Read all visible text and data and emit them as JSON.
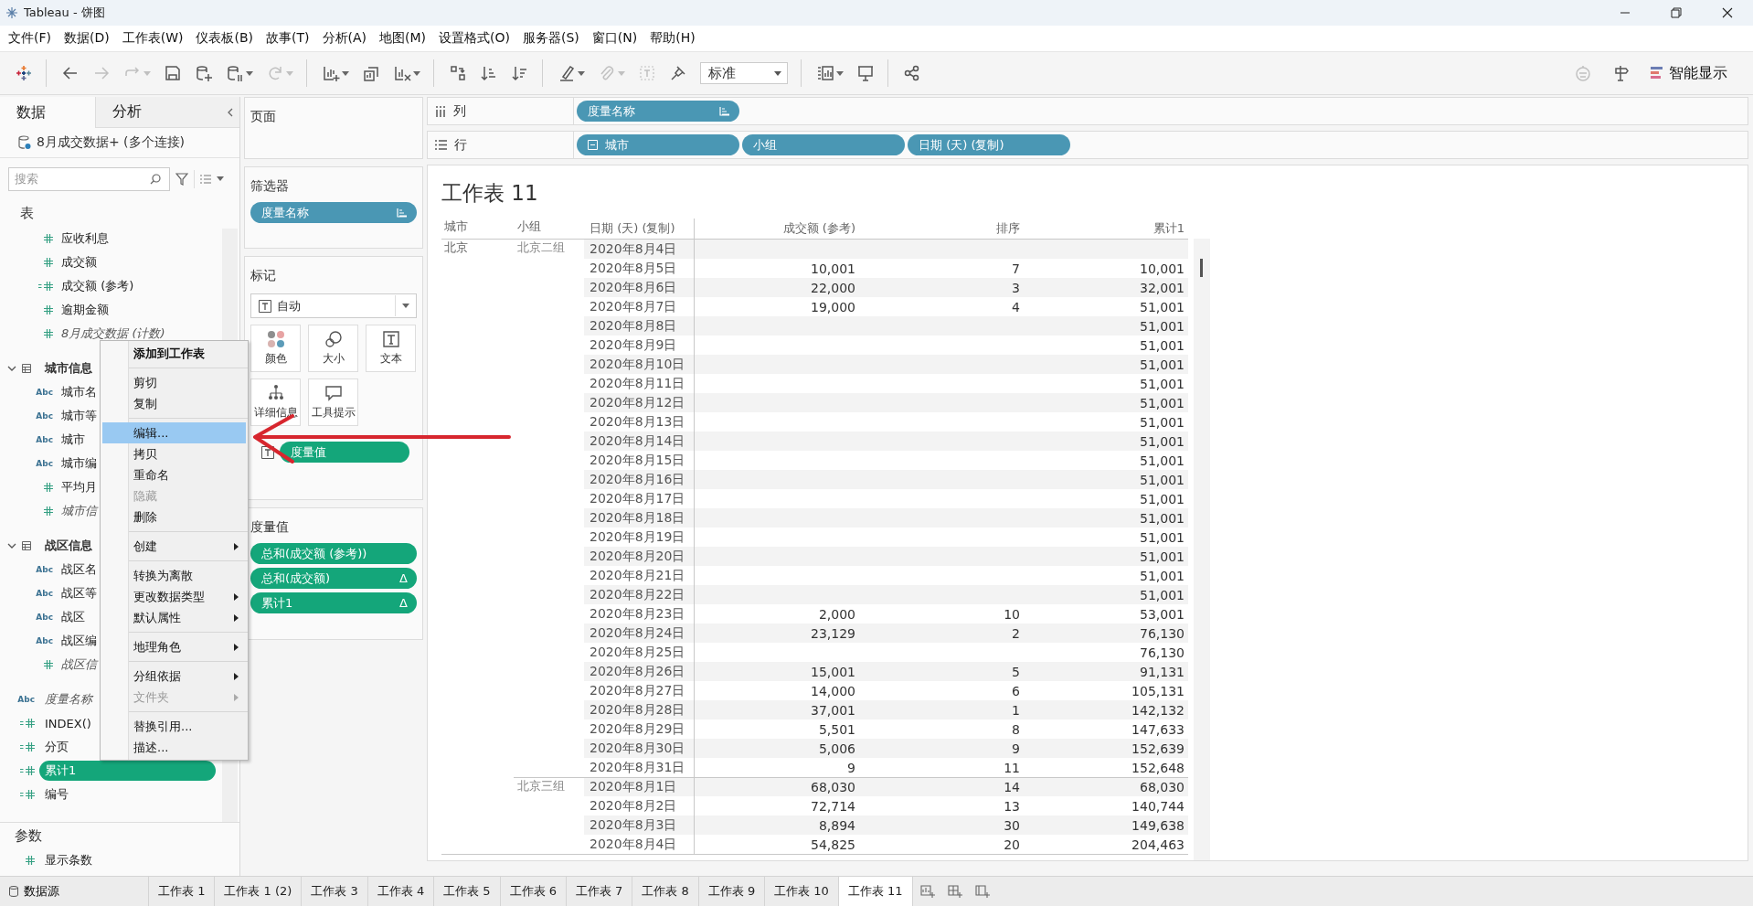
{
  "window": {
    "title": "Tableau - 饼图"
  },
  "menu_bar": [
    "文件(F)",
    "数据(D)",
    "工作表(W)",
    "仪表板(B)",
    "故事(T)",
    "分析(A)",
    "地图(M)",
    "设置格式(O)",
    "服务器(S)",
    "窗口(N)",
    "帮助(H)"
  ],
  "toolbar": {
    "buttons": [
      {
        "kind": "logo",
        "disabled": false,
        "dropdown": false
      },
      {
        "kind": "separator"
      },
      {
        "kind": "back",
        "disabled": false,
        "dropdown": false
      },
      {
        "kind": "forward",
        "disabled": true,
        "dropdown": false
      },
      {
        "kind": "redo",
        "disabled": true,
        "dropdown": true
      },
      {
        "kind": "save",
        "disabled": false,
        "dropdown": false
      },
      {
        "kind": "new-data-source",
        "disabled": false,
        "dropdown": false
      },
      {
        "kind": "pause-updates",
        "disabled": false,
        "dropdown": true
      },
      {
        "kind": "refresh",
        "disabled": true,
        "dropdown": true
      },
      {
        "kind": "separator"
      },
      {
        "kind": "new-sheet",
        "disabled": false,
        "dropdown": true
      },
      {
        "kind": "duplicate",
        "disabled": false,
        "dropdown": false
      },
      {
        "kind": "clear",
        "disabled": false,
        "dropdown": true
      },
      {
        "kind": "separator"
      },
      {
        "kind": "swap",
        "disabled": false,
        "dropdown": false
      },
      {
        "kind": "sort-asc",
        "disabled": false,
        "dropdown": false
      },
      {
        "kind": "sort-desc",
        "disabled": false,
        "dropdown": false
      },
      {
        "kind": "separator"
      },
      {
        "kind": "highlight",
        "disabled": false,
        "dropdown": true
      },
      {
        "kind": "group",
        "disabled": true,
        "dropdown": true
      },
      {
        "kind": "labels",
        "disabled": true,
        "dropdown": false
      },
      {
        "kind": "pin",
        "disabled": false,
        "dropdown": false
      },
      {
        "kind": "select",
        "value": "标准"
      },
      {
        "kind": "separator"
      },
      {
        "kind": "show-cards",
        "disabled": false,
        "dropdown": true
      },
      {
        "kind": "presentation",
        "disabled": false,
        "dropdown": false
      },
      {
        "kind": "separator"
      },
      {
        "kind": "share",
        "disabled": false,
        "dropdown": false
      }
    ],
    "right": [
      {
        "kind": "assistant",
        "disabled": true
      },
      {
        "kind": "signpost",
        "disabled": false
      },
      {
        "kind": "show-me",
        "label": "智能显示"
      }
    ]
  },
  "data_pane": {
    "tabs": [
      {
        "label": "数据",
        "selected": true
      },
      {
        "label": "分析",
        "selected": false
      }
    ],
    "data_source": "8月成交数据+ (多个连接)",
    "search": {
      "placeholder": "搜索"
    },
    "section_title": "表",
    "table_fields": [
      {
        "name": "应收利息",
        "kind": "measure",
        "italic": false,
        "selected": false
      },
      {
        "name": "成交额",
        "kind": "measure",
        "italic": false,
        "selected": false
      },
      {
        "name": "成交额 (参考)",
        "kind": "calc",
        "italic": false,
        "selected": false
      },
      {
        "name": "逾期金额",
        "kind": "measure",
        "italic": false,
        "selected": false
      },
      {
        "name": "8月成交数据 (计数)",
        "kind": "measure",
        "italic": true,
        "selected": false
      }
    ],
    "folders": [
      {
        "name": "城市信息",
        "expanded": true,
        "children": [
          {
            "name": "城市名",
            "kind": "dimension",
            "type_label": "Abc",
            "italic": false,
            "selected": false
          },
          {
            "name": "城市等",
            "kind": "dimension",
            "type_label": "Abc",
            "italic": false,
            "selected": false
          },
          {
            "name": "城市",
            "kind": "dimension",
            "type_label": "Abc",
            "italic": false,
            "selected": false
          },
          {
            "name": "城市编",
            "kind": "dimension",
            "type_label": "Abc",
            "italic": false,
            "selected": false
          },
          {
            "name": "平均月",
            "kind": "measure",
            "italic": false,
            "selected": false
          },
          {
            "name": "城市信",
            "kind": "measure",
            "italic": true,
            "selected": false
          }
        ]
      },
      {
        "name": "战区信息",
        "expanded": true,
        "children": [
          {
            "name": "战区名",
            "kind": "dimension",
            "type_label": "Abc",
            "italic": false,
            "selected": false
          },
          {
            "name": "战区等",
            "kind": "dimension",
            "type_label": "Abc",
            "italic": false,
            "selected": false
          },
          {
            "name": "战区",
            "kind": "dimension",
            "type_label": "Abc",
            "italic": false,
            "selected": false
          },
          {
            "name": "战区编",
            "kind": "dimension",
            "type_label": "Abc",
            "italic": false,
            "selected": false
          },
          {
            "name": "战区信",
            "kind": "measure",
            "italic": true,
            "selected": false
          }
        ]
      }
    ],
    "fields": [
      {
        "name": "度量名称",
        "kind": "dimension",
        "type_label": "Abc",
        "italic": true,
        "selected": false
      },
      {
        "name": "INDEX()",
        "kind": "calc",
        "italic": false,
        "selected": false
      },
      {
        "name": "分页",
        "kind": "calc",
        "italic": false,
        "selected": false
      },
      {
        "name": "累计1",
        "kind": "calc",
        "italic": false,
        "selected": true
      },
      {
        "name": "编号",
        "kind": "calc",
        "italic": false,
        "selected": false
      }
    ],
    "parameters": {
      "title": "参数",
      "items": [
        {
          "name": "显示条数",
          "kind": "measure",
          "italic": false,
          "selected": false
        }
      ]
    }
  },
  "context_menu": {
    "groups": [
      [
        {
          "label": "添加到工作表",
          "bold": true,
          "selected": false,
          "disabled": false,
          "submenu": false
        }
      ],
      [
        {
          "label": "剪切",
          "selected": false,
          "disabled": false,
          "submenu": false
        },
        {
          "label": "复制",
          "selected": false,
          "disabled": false,
          "submenu": false
        }
      ],
      [
        {
          "label": "编辑...",
          "selected": true,
          "disabled": false,
          "submenu": false
        },
        {
          "label": "拷贝",
          "selected": false,
          "disabled": false,
          "submenu": false
        },
        {
          "label": "重命名",
          "selected": false,
          "disabled": false,
          "submenu": false
        },
        {
          "label": "隐藏",
          "selected": false,
          "disabled": true,
          "submenu": false
        },
        {
          "label": "删除",
          "selected": false,
          "disabled": false,
          "submenu": false
        }
      ],
      [
        {
          "label": "创建",
          "selected": false,
          "disabled": false,
          "submenu": true
        }
      ],
      [
        {
          "label": "转换为离散",
          "selected": false,
          "disabled": false,
          "submenu": false
        },
        {
          "label": "更改数据类型",
          "selected": false,
          "disabled": false,
          "submenu": true
        },
        {
          "label": "默认属性",
          "selected": false,
          "disabled": false,
          "submenu": true
        }
      ],
      [
        {
          "label": "地理角色",
          "selected": false,
          "disabled": false,
          "submenu": true
        }
      ],
      [
        {
          "label": "分组依据",
          "selected": false,
          "disabled": false,
          "submenu": true
        },
        {
          "label": "文件夹",
          "selected": false,
          "disabled": true,
          "submenu": true
        }
      ],
      [
        {
          "label": "替换引用...",
          "selected": false,
          "disabled": false,
          "submenu": false
        },
        {
          "label": "描述...",
          "selected": false,
          "disabled": false,
          "submenu": false
        }
      ]
    ]
  },
  "cards": {
    "pages": {
      "title": "页面"
    },
    "filters": {
      "title": "筛选器",
      "pills": [
        {
          "label": "度量名称",
          "kind": "measure-names"
        }
      ]
    },
    "marks": {
      "title": "标记",
      "mark_type": "自动",
      "buttons": [
        {
          "label": "颜色",
          "kind": "color"
        },
        {
          "label": "大小",
          "kind": "size"
        },
        {
          "label": "文本",
          "kind": "text"
        },
        {
          "label": "详细信息",
          "kind": "detail"
        },
        {
          "label": "工具提示",
          "kind": "tooltip"
        }
      ],
      "pills": [
        {
          "label": "度量值",
          "kind": "measure"
        }
      ]
    },
    "measure_values": {
      "title": "度量值",
      "pills": [
        {
          "label": "总和(成交额 (参考))",
          "kind": "measure"
        },
        {
          "label": "总和(成交额)",
          "kind": "measure",
          "suffix": "Δ"
        },
        {
          "label": "累计1",
          "kind": "measure",
          "suffix": "Δ"
        }
      ]
    }
  },
  "columns_shelf": {
    "label": "列",
    "pills": [
      {
        "label": "度量名称",
        "kind": "measure-names"
      }
    ]
  },
  "rows_shelf": {
    "label": "行",
    "pills": [
      {
        "label": "城市",
        "kind": "hierarchy"
      },
      {
        "label": "小组",
        "kind": "dimension"
      },
      {
        "label": "日期 (天) (复制)",
        "kind": "dimension"
      }
    ]
  },
  "view": {
    "title": "工作表 11",
    "columns": [
      "城市",
      "小组",
      "日期 (天) (复制)",
      "成交额 (参考)",
      "排序",
      "累计1"
    ],
    "groups": [
      {
        "city": "北京",
        "subgroups": [
          {
            "name": "北京二组",
            "rows": [
              {
                "date": "2020年8月4日"
              },
              {
                "date": "2020年8月5日",
                "amount": "10,001",
                "rank": "7",
                "total": "10,001"
              },
              {
                "date": "2020年8月6日",
                "amount": "22,000",
                "rank": "3",
                "total": "32,001"
              },
              {
                "date": "2020年8月7日",
                "amount": "19,000",
                "rank": "4",
                "total": "51,001"
              },
              {
                "date": "2020年8月8日",
                "total": "51,001"
              },
              {
                "date": "2020年8月9日",
                "total": "51,001"
              },
              {
                "date": "2020年8月10日",
                "total": "51,001"
              },
              {
                "date": "2020年8月11日",
                "total": "51,001"
              },
              {
                "date": "2020年8月12日",
                "total": "51,001"
              },
              {
                "date": "2020年8月13日",
                "total": "51,001"
              },
              {
                "date": "2020年8月14日",
                "total": "51,001"
              },
              {
                "date": "2020年8月15日",
                "total": "51,001"
              },
              {
                "date": "2020年8月16日",
                "total": "51,001"
              },
              {
                "date": "2020年8月17日",
                "total": "51,001"
              },
              {
                "date": "2020年8月18日",
                "total": "51,001"
              },
              {
                "date": "2020年8月19日",
                "total": "51,001"
              },
              {
                "date": "2020年8月20日",
                "total": "51,001"
              },
              {
                "date": "2020年8月21日",
                "total": "51,001"
              },
              {
                "date": "2020年8月22日",
                "total": "51,001"
              },
              {
                "date": "2020年8月23日",
                "amount": "2,000",
                "rank": "10",
                "total": "53,001"
              },
              {
                "date": "2020年8月24日",
                "amount": "23,129",
                "rank": "2",
                "total": "76,130"
              },
              {
                "date": "2020年8月25日",
                "total": "76,130"
              },
              {
                "date": "2020年8月26日",
                "amount": "15,001",
                "rank": "5",
                "total": "91,131"
              },
              {
                "date": "2020年8月27日",
                "amount": "14,000",
                "rank": "6",
                "total": "105,131"
              },
              {
                "date": "2020年8月28日",
                "amount": "37,001",
                "rank": "1",
                "total": "142,132"
              },
              {
                "date": "2020年8月29日",
                "amount": "5,501",
                "rank": "8",
                "total": "147,633"
              },
              {
                "date": "2020年8月30日",
                "amount": "5,006",
                "rank": "9",
                "total": "152,639"
              },
              {
                "date": "2020年8月31日",
                "amount": "9",
                "rank": "11",
                "total": "152,648"
              }
            ]
          },
          {
            "name": "北京三组",
            "rows": [
              {
                "date": "2020年8月1日",
                "amount": "68,030",
                "rank": "14",
                "total": "68,030"
              },
              {
                "date": "2020年8月2日",
                "amount": "72,714",
                "rank": "13",
                "total": "140,744"
              },
              {
                "date": "2020年8月3日",
                "amount": "8,894",
                "rank": "30",
                "total": "149,638"
              },
              {
                "date": "2020年8月4日",
                "amount": "54,825",
                "rank": "20",
                "total": "204,463"
              }
            ]
          }
        ]
      }
    ]
  },
  "sheet_tabs": {
    "data_source": "数据源",
    "tabs": [
      {
        "label": "工作表 1",
        "selected": false
      },
      {
        "label": "工作表 1 (2)",
        "selected": false
      },
      {
        "label": "工作表 3",
        "selected": false
      },
      {
        "label": "工作表 4",
        "selected": false
      },
      {
        "label": "工作表 5",
        "selected": false
      },
      {
        "label": "工作表 6",
        "selected": false
      },
      {
        "label": "工作表 7",
        "selected": false
      },
      {
        "label": "工作表 8",
        "selected": false
      },
      {
        "label": "工作表 9",
        "selected": false
      },
      {
        "label": "工作表 10",
        "selected": false
      },
      {
        "label": "工作表 11",
        "selected": true
      }
    ]
  }
}
